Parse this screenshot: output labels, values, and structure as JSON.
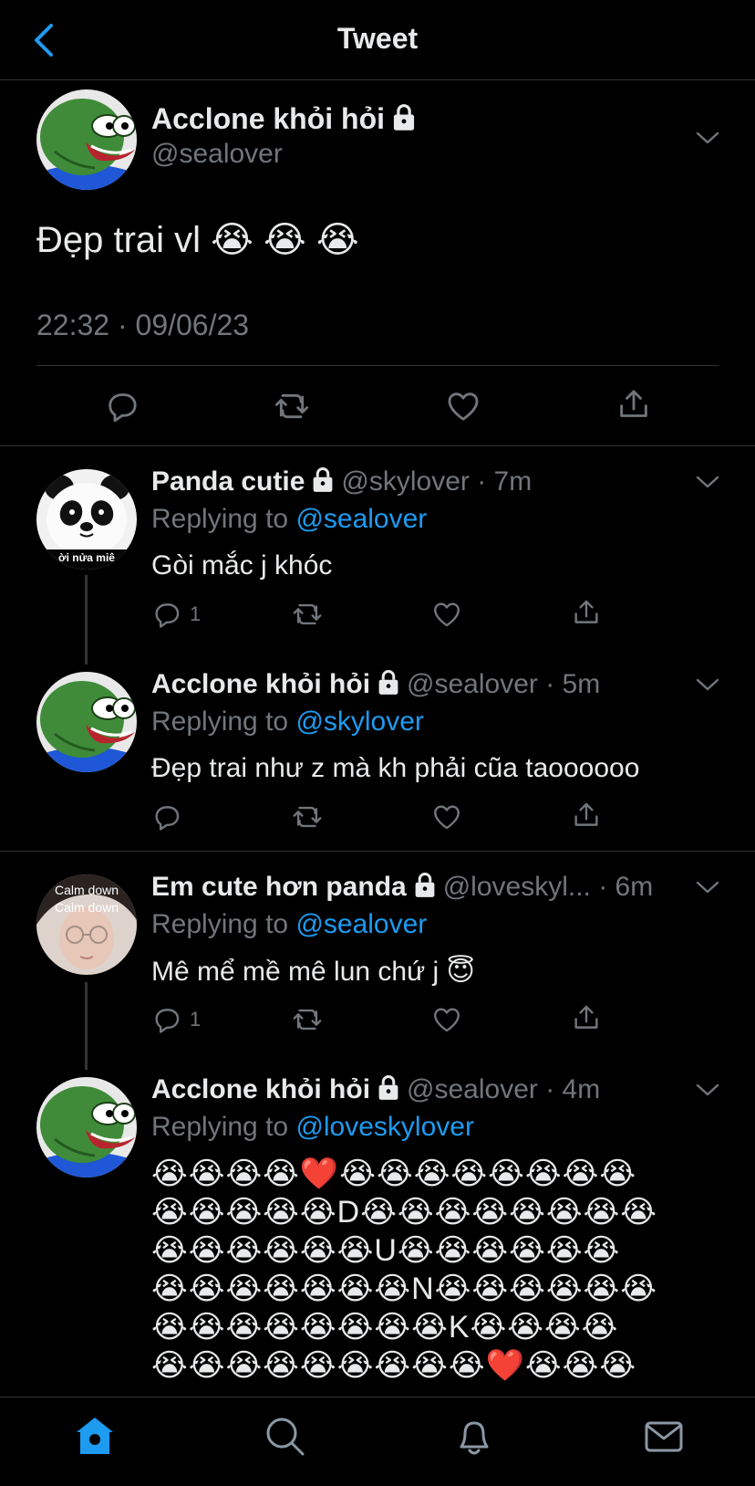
{
  "header": {
    "title": "Tweet",
    "back_icon": "chevron-left-icon"
  },
  "main_tweet": {
    "name": "Acclone khỏi hỏi",
    "handle": "@sealover",
    "text": "Đẹp trai vl 😭 😭 😭",
    "timestamp": "22:32 · 09/06/23"
  },
  "replies": [
    {
      "name": "Panda cutie",
      "meta": "@skylover · 7m",
      "replying_prefix": "Replying to",
      "replying_to": "@sealover",
      "text": "Gòi mắc j khóc",
      "reply_count": "1",
      "avatar_caption": "ời nửa miê"
    },
    {
      "name": "Acclone khỏi hỏi",
      "meta": "@sealover · 5m",
      "replying_prefix": "Replying to",
      "replying_to": "@skylover",
      "text": "Đẹp trai như z mà kh phải cũa taoooooo"
    },
    {
      "name": "Em cute hơn panda",
      "meta": "@loveskyl... · 6m",
      "replying_prefix": "Replying to",
      "replying_to": "@sealover",
      "text": "Mê mể mề mê lun chứ j 😇",
      "reply_count": "1",
      "avatar_caption_1": "Calm down",
      "avatar_caption_2": "Calm down"
    },
    {
      "name": "Acclone khỏi hỏi",
      "meta": "@sealover · 4m",
      "replying_prefix": "Replying to",
      "replying_to": "@loveskylover",
      "lines": [
        "😭😭😭😭❤️😭😭😭😭😭😭😭😭",
        "😭😭😭😭😭D😭😭😭😭😭😭😭😭",
        "😭😭😭😭😭😭U😭😭😭😭😭😭",
        "😭😭😭😭😭😭😭N😭😭😭😭😭😭",
        "😭😭😭😭😭😭😭😭K😭😭😭😭",
        "😭😭😭😭😭😭😭😭😭❤️😭😭😭"
      ]
    }
  ],
  "tabbar": {
    "tabs": [
      "home-icon",
      "search-icon",
      "notifications-icon",
      "messages-icon"
    ]
  },
  "colors": {
    "background": "#000000",
    "accent": "#1d9bf0",
    "muted": "#71767b",
    "divider": "#2f3336"
  }
}
